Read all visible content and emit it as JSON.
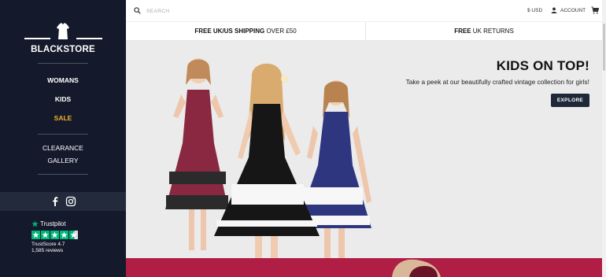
{
  "brand": {
    "name": "BLACKSTORE"
  },
  "nav": {
    "primary": [
      {
        "label": "WOMANS"
      },
      {
        "label": "KIDS"
      },
      {
        "label": "SALE"
      }
    ],
    "secondary": [
      {
        "label": "CLEARANCE"
      },
      {
        "label": "GALLERY"
      }
    ]
  },
  "social": {
    "icons": [
      "facebook-icon",
      "instagram-icon"
    ]
  },
  "trustpilot": {
    "logo": "Trustpilot",
    "score": "TrustScore 4.7",
    "reviews": "1,585 reviews",
    "star_color": "#00b67a"
  },
  "header": {
    "search_placeholder": "SEARCH",
    "currency": "$ USD",
    "account": "ACCOUNT"
  },
  "shipping": {
    "left_bold": "FREE UK/US SHIPPING",
    "left_rest": " OVER £50",
    "right_bold": "FREE",
    "right_rest": " UK RETURNS"
  },
  "hero": {
    "title": "KIDS ON TOP!",
    "subtitle": "Take a peek at our beautifully crafted vintage collection for girls!",
    "button": "EXPLORE"
  },
  "colors": {
    "sidebar": "#141a2b",
    "sale": "#f0b429",
    "button": "#1e2838",
    "banner": "#b01e45"
  }
}
